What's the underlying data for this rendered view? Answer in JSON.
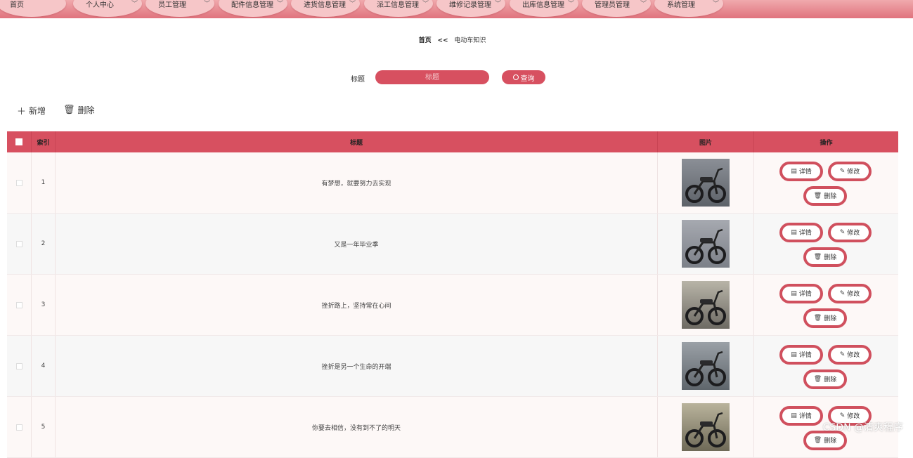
{
  "nav": {
    "items": [
      {
        "label": "首页",
        "has_caret": false
      },
      {
        "label": "个人中心",
        "has_caret": true
      },
      {
        "label": "员工管理",
        "has_caret": true
      },
      {
        "label": "配件信息管理",
        "has_caret": true
      },
      {
        "label": "进货信息管理",
        "has_caret": true
      },
      {
        "label": "派工信息管理",
        "has_caret": true
      },
      {
        "label": "维修记录管理",
        "has_caret": true
      },
      {
        "label": "出库信息管理",
        "has_caret": true
      },
      {
        "label": "管理员管理",
        "has_caret": true
      },
      {
        "label": "系统管理",
        "has_caret": true
      }
    ],
    "caret": "﹀"
  },
  "breadcrumb": {
    "home": "首页",
    "separator": "<<",
    "current": "电动车知识"
  },
  "search": {
    "label": "标题",
    "placeholder": "标题",
    "button_label": "查询"
  },
  "toolbar": {
    "add_label": "新增",
    "delete_label": "删除",
    "add_glyph": "＋",
    "delete_glyph": "🗑"
  },
  "table": {
    "columns": {
      "index": "索引",
      "title": "标题",
      "image": "图片",
      "actions": "操作"
    },
    "rows": [
      {
        "index": "1",
        "title": "有梦想，就要努力去实现"
      },
      {
        "index": "2",
        "title": "又是一年毕业季"
      },
      {
        "index": "3",
        "title": "挫折路上，坚持常在心间"
      },
      {
        "index": "4",
        "title": "挫折是另一个生命的开端"
      },
      {
        "index": "5",
        "title": "你要去相信，没有到不了的明天"
      }
    ],
    "actions": {
      "detail": "详情",
      "edit": "修改",
      "delete": "删除"
    }
  },
  "watermark": "CSDN @清爽程序",
  "colors": {
    "accent": "#d75060",
    "nav_bg": "#e0737d",
    "nav_pill": "#f6c6c8",
    "button_border": "#d0505e"
  }
}
